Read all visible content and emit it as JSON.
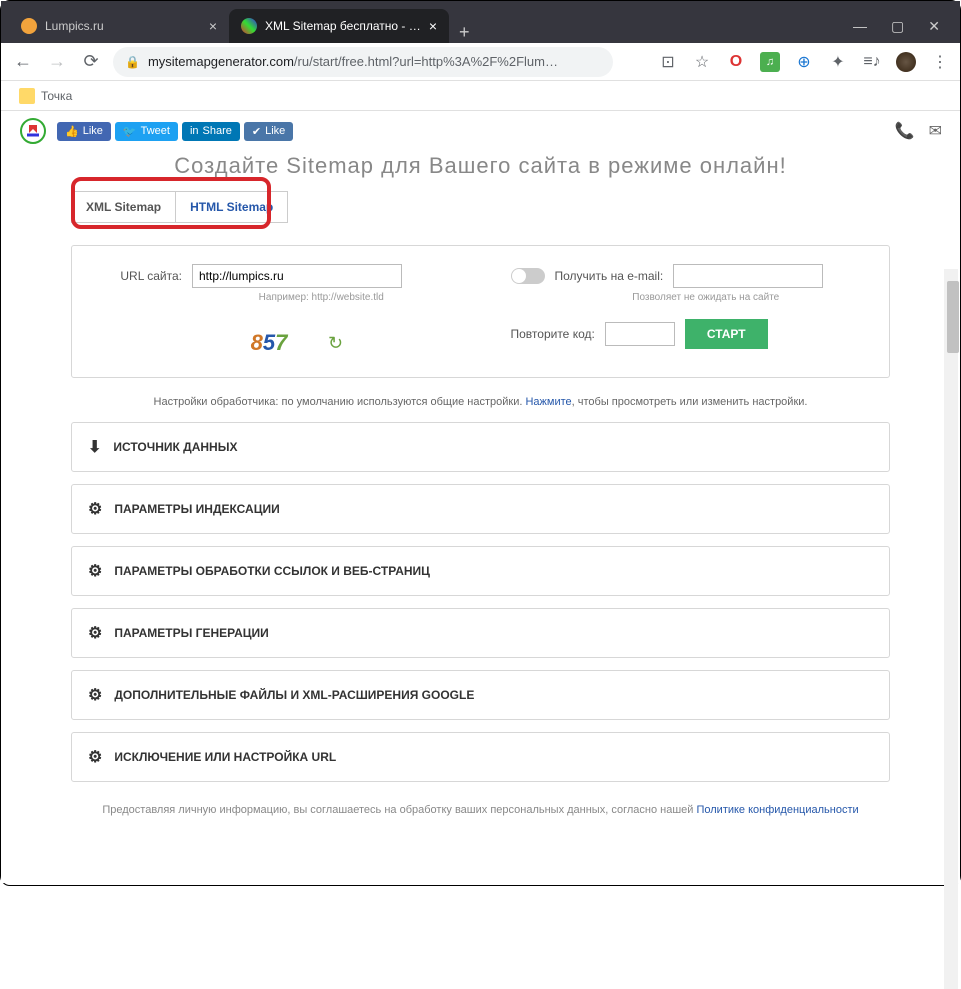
{
  "browser": {
    "tabs": [
      {
        "title": "Lumpics.ru",
        "active": false
      },
      {
        "title": "XML Sitemap бесплатно - Генер",
        "active": true
      }
    ],
    "url_domain": "mysitemapgenerator.com",
    "url_path": "/ru/start/free.html?url=http%3A%2F%2Flum…",
    "bookmark_label": "Точка"
  },
  "social": {
    "fb": "Like",
    "tw": "Tweet",
    "li": "Share",
    "vk": "Like"
  },
  "page_title": "Создайте Sitemap для Вашего сайта в режиме онлайн!",
  "type_tabs": {
    "xml": "XML Sitemap",
    "html": "HTML Sitemap"
  },
  "form": {
    "url_label": "URL сайта:",
    "url_value": "http://lumpics.ru",
    "url_hint": "Например: http://website.tld",
    "email_label": "Получить на e-mail:",
    "email_hint": "Позволяет не ожидать на сайте",
    "captcha_label": "Повторите код:",
    "captcha_digits": [
      "8",
      "5",
      "7"
    ],
    "start_btn": "СТАРТ"
  },
  "settings_note": {
    "prefix": "Настройки обработчика: по умолчанию используются общие настройки. ",
    "link": "Нажмите",
    "suffix": ", чтобы просмотреть или изменить настройки."
  },
  "accordions": [
    {
      "icon": "download",
      "label": "ИСТОЧНИК ДАННЫХ"
    },
    {
      "icon": "gear",
      "label": "ПАРАМЕТРЫ ИНДЕКСАЦИИ"
    },
    {
      "icon": "gear",
      "label": "ПАРАМЕТРЫ ОБРАБОТКИ ССЫЛОК И ВЕБ-СТРАНИЦ"
    },
    {
      "icon": "gear",
      "label": "ПАРАМЕТРЫ ГЕНЕРАЦИИ"
    },
    {
      "icon": "gear",
      "label": "ДОПОЛНИТЕЛЬНЫЕ ФАЙЛЫ И XML-РАСШИРЕНИЯ GOOGLE"
    },
    {
      "icon": "gear",
      "label": "ИСКЛЮЧЕНИЕ ИЛИ НАСТРОЙКА URL"
    }
  ],
  "footer": {
    "text": "Предоставляя личную информацию, вы соглашаетесь на обработку ваших персональных данных, согласно нашей ",
    "link": "Политике конфиденциальности"
  }
}
